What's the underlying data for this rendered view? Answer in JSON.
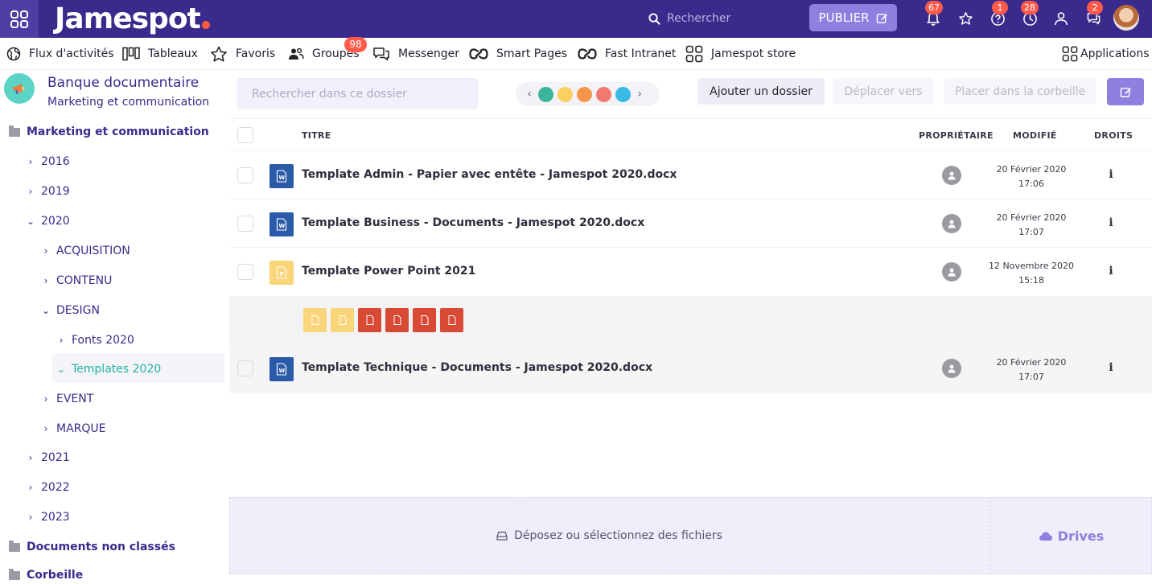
{
  "topbar": {
    "logo": "Jamespot",
    "search_placeholder": "Rechercher",
    "publish_label": "PUBLIER",
    "badges": {
      "notifications": "67",
      "help": "1",
      "history": "28",
      "messages": "2"
    }
  },
  "nav": {
    "items": [
      {
        "label": "Flux d'activités",
        "icon": "globe-icon"
      },
      {
        "label": "Tableaux",
        "icon": "kanban-icon"
      },
      {
        "label": "Favoris",
        "icon": "star-icon"
      },
      {
        "label": "Groupes",
        "icon": "users-icon",
        "badge": "98"
      },
      {
        "label": "Messenger",
        "icon": "chat-icon"
      },
      {
        "label": "Smart Pages",
        "icon": "link-icon"
      },
      {
        "label": "Fast Intranet",
        "icon": "link-icon"
      },
      {
        "label": "Jamespot store",
        "icon": "grid-icon"
      }
    ],
    "applications_label": "Applications"
  },
  "sidebar": {
    "title": "Banque documentaire",
    "subtitle": "Marketing et communication",
    "tree": [
      {
        "label": "Marketing et communication",
        "level": 0
      },
      {
        "label": "2016",
        "level": 1
      },
      {
        "label": "2019",
        "level": 1
      },
      {
        "label": "2020",
        "level": 1
      },
      {
        "label": "ACQUISITION",
        "level": 2
      },
      {
        "label": "CONTENU",
        "level": 2
      },
      {
        "label": "DESIGN",
        "level": 2
      },
      {
        "label": "Fonts 2020",
        "level": 3
      },
      {
        "label": "Templates 2020",
        "level": 3
      },
      {
        "label": "EVENT",
        "level": 2
      },
      {
        "label": "MARQUE",
        "level": 2
      },
      {
        "label": "2021",
        "level": 1
      },
      {
        "label": "2022",
        "level": 1
      },
      {
        "label": "2023",
        "level": 1
      },
      {
        "label": "Documents non classés",
        "level": 0
      },
      {
        "label": "Corbeille",
        "level": 0
      }
    ]
  },
  "toolbar": {
    "folder_search_placeholder": "Rechercher dans ce dossier",
    "palette_colors": [
      "#3cb59b",
      "#fbd05e",
      "#f5964a",
      "#f07a72",
      "#3ab8e6"
    ],
    "add_folder": "Ajouter un dossier",
    "move_to": "Déplacer vers",
    "trash": "Placer dans la corbeille"
  },
  "table": {
    "headers": {
      "title": "TITRE",
      "owner": "PROPRIÉTAIRE",
      "modified": "MODIFIÉ",
      "rights": "DROITS"
    },
    "rows": [
      {
        "name": "Template Admin - Papier avec entête - Jamespot 2020.docx",
        "type": "word",
        "date": "20 Février 2020",
        "time": "17:06"
      },
      {
        "name": "Template Business - Documents - Jamespot 2020.docx",
        "type": "word",
        "date": "20 Février 2020",
        "time": "17:07"
      },
      {
        "name": "Template Power Point 2021",
        "type": "ppt",
        "date": "12 Novembre 2020",
        "time": "15:18"
      },
      {
        "name": "Template Technique - Documents - Jamespot 2020.docx",
        "type": "word",
        "date": "20 Février 2020",
        "time": "17:07"
      }
    ]
  },
  "dropzone": {
    "label": "Déposez ou sélectionnez des fichiers",
    "drives_label": "Drives"
  },
  "colors": {
    "primary": "#3a2a8c",
    "accent": "#8e7fe0",
    "teal": "#20b3a0",
    "badge": "#ff5a4a",
    "word": "#2b5ba8",
    "ppt": "#fbd57a",
    "pdf": "#d84a35"
  }
}
